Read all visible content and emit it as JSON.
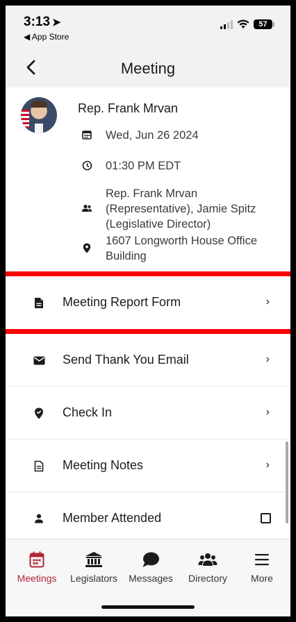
{
  "status": {
    "time": "3:13",
    "back_app": "◀ App Store",
    "battery": "57"
  },
  "nav": {
    "title": "Meeting"
  },
  "meeting": {
    "rep_name": "Rep. Frank Mrvan",
    "date": "Wed, Jun 26 2024",
    "time": "01:30 PM EDT",
    "attendees": "Rep. Frank Mrvan (Representative), Jamie Spitz (Legislative Director)",
    "location": "1607 Longworth House Office Building"
  },
  "menu": [
    {
      "label": "Meeting Report Form",
      "icon": "document-icon"
    },
    {
      "label": "Send Thank You Email",
      "icon": "envelope-icon"
    },
    {
      "label": "Check In",
      "icon": "location-check-icon"
    },
    {
      "label": "Meeting Notes",
      "icon": "notes-icon"
    },
    {
      "label": "Member Attended",
      "icon": "person-icon"
    }
  ],
  "tabs": [
    {
      "label": "Meetings",
      "icon": "calendar-icon",
      "active": true
    },
    {
      "label": "Legislators",
      "icon": "capitol-icon"
    },
    {
      "label": "Messages",
      "icon": "chat-bubble-icon"
    },
    {
      "label": "Directory",
      "icon": "people-icon"
    },
    {
      "label": "More",
      "icon": "hamburger-icon"
    }
  ],
  "colors": {
    "accent": "#b3263a",
    "highlight": "#ff0000"
  }
}
